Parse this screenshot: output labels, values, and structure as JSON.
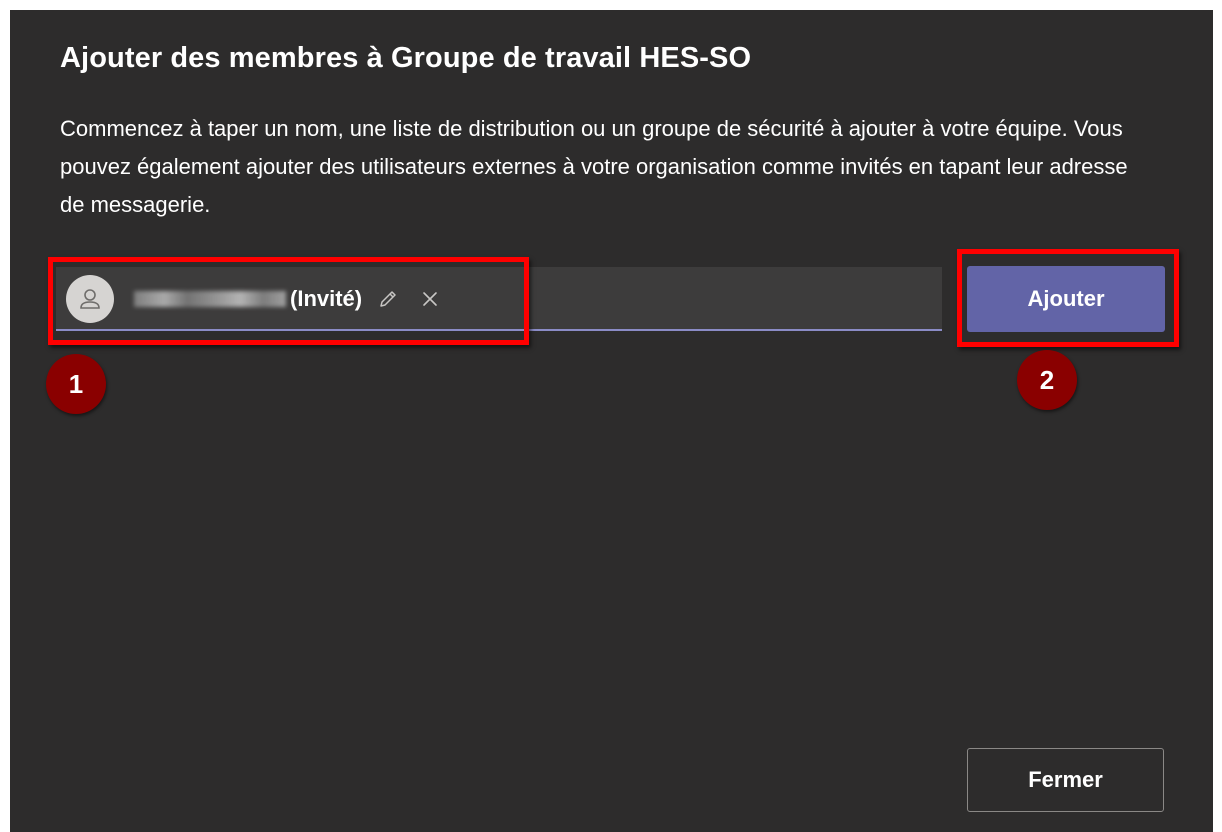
{
  "dialog": {
    "title": "Ajouter des membres à Groupe de travail HES-SO",
    "description": "Commencez à taper un nom, une liste de distribution ou un groupe de sécurité à ajouter à votre équipe. Vous pouvez également ajouter des utilisateurs externes à votre organisation comme invités en tapant leur adresse de messagerie."
  },
  "picker": {
    "chip": {
      "guest_label": "(Invité)",
      "avatar_icon": "person-icon",
      "edit_icon": "pencil-icon",
      "remove_icon": "close-icon"
    }
  },
  "buttons": {
    "add_label": "Ajouter",
    "close_label": "Fermer"
  },
  "annotations": {
    "badge_1": "1",
    "badge_2": "2"
  },
  "colors": {
    "dialog_bg": "#2d2c2c",
    "accent": "#6264a7",
    "annotation": "#ff0000",
    "badge": "#8a0000"
  }
}
